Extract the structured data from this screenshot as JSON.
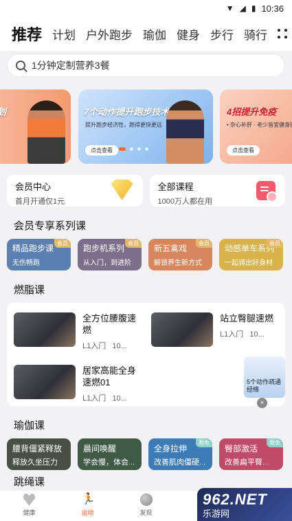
{
  "status": {
    "time": "10:36"
  },
  "tabs": [
    "推荐",
    "计划",
    "户外跑步",
    "瑜伽",
    "健身",
    "步行",
    "骑行"
  ],
  "search": {
    "text": "1分钟定制营养3餐"
  },
  "banners": {
    "left_title": "划",
    "mid_title": "7个动作提升跑步技术",
    "mid_sub": "提升跑步经济性，跑得更快更远",
    "mid_button": "点击查看",
    "right_title": "4招提升免疫",
    "right_sub": "• 杂心补肝 · 老少皆宜健身操",
    "right_button": "点击查看"
  },
  "member": {
    "center_title": "会员中心",
    "center_sub": "首月开通仅1元",
    "courses_title": "全部课程",
    "courses_sub": "1000万人都在用"
  },
  "vip_section": {
    "title": "会员专享系列课",
    "items": [
      {
        "title": "精品跑步课",
        "sub": "无伤畅跑",
        "badge": "会员",
        "color": "#5a7fb0"
      },
      {
        "title": "跑步机系列",
        "sub": "从入门，到进阶",
        "badge": "会员",
        "color": "#7d6f8c"
      },
      {
        "title": "新五禽戏",
        "sub": "解锁养生新方式",
        "badge": "会员",
        "color": "#d8865c"
      },
      {
        "title": "动感单车系列",
        "sub": "一起骑出好身材",
        "badge": "会员",
        "color": "#d8b24a"
      }
    ]
  },
  "burn_section": {
    "title": "燃脂课",
    "items": [
      {
        "title": "全方位腰腹速燃",
        "level": "L1入门",
        "duration": "10..."
      },
      {
        "title": "站立臀腿速燃",
        "level": "L1入门",
        "duration": "10..."
      },
      {
        "title": "居家高能全身速燃01",
        "level": "L1入门",
        "duration": "10..."
      }
    ],
    "float_ad": "5个动作疏通经络"
  },
  "yoga_section": {
    "title": "瑜伽课",
    "items": [
      {
        "title": "腰背僵紧释放",
        "sub": "释放久坐压力",
        "badge": "",
        "color": "#4a4f46"
      },
      {
        "title": "晨间唤醒",
        "sub": "学会慢，体会...",
        "badge": "",
        "color": "#3f5a45"
      },
      {
        "title": "全身拉伸",
        "sub": "改善肌肉僵硬...",
        "badge": "限免",
        "color": "#3d7ab8"
      },
      {
        "title": "臀部激活",
        "sub": "改善扁平臀...",
        "badge": "限免",
        "color": "#c04a68"
      }
    ]
  },
  "rope_section": {
    "title": "跳绳课"
  },
  "bottom_nav": [
    {
      "label": "健康",
      "icon": "heart-icon"
    },
    {
      "label": "运动",
      "icon": "runner-icon"
    },
    {
      "label": "发现",
      "icon": "globe-icon"
    }
  ],
  "watermark": {
    "big": "962.NET",
    "small": "乐游网"
  }
}
